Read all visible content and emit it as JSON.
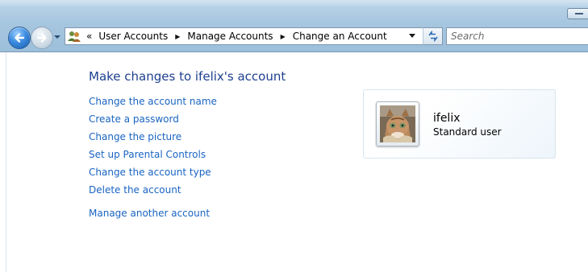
{
  "address_bar": {
    "chevron": "«",
    "crumbs": [
      "User Accounts",
      "Manage Accounts",
      "Change an Account"
    ]
  },
  "search": {
    "placeholder": "Search"
  },
  "main": {
    "heading": "Make changes to ifelix's account",
    "tasks": [
      "Change the account name",
      "Create a password",
      "Change the picture",
      "Set up Parental Controls",
      "Change the account type",
      "Delete the account"
    ],
    "other_task": "Manage another account"
  },
  "account": {
    "name": "ifelix",
    "type": "Standard user",
    "picture": "kitten-photo-icon"
  },
  "colors": {
    "link": "#1964c2",
    "heading": "#1e3f8f",
    "chrome": "#a7c6df"
  },
  "icons": {
    "back": "back-arrow-icon",
    "forward": "forward-arrow-icon",
    "address": "user-accounts-icon",
    "refresh": "refresh-icon"
  }
}
